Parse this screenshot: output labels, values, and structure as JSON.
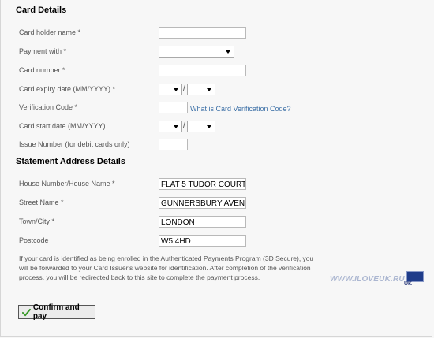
{
  "card_details": {
    "title": "Card Details",
    "holder_name_label": "Card holder name *",
    "payment_with_label": "Payment with *",
    "card_number_label": "Card number *",
    "expiry_label": "Card expiry date (MM/YYYY) *",
    "verification_label": "Verification Code *",
    "verification_link": "What is Card Verification Code?",
    "start_date_label": "Card start date (MM/YYYY)",
    "issue_number_label": "Issue Number (for debit cards only)",
    "date_separator": "/"
  },
  "address_details": {
    "title": "Statement Address Details",
    "house_label": "House Number/House Name *",
    "house_value": "FLAT 5 TUDOR COURT",
    "street_label": "Street Name *",
    "street_value": "GUNNERSBURY AVENU",
    "town_label": "Town/City *",
    "town_value": "LONDON",
    "postcode_label": "Postcode",
    "postcode_value": "W5 4HD"
  },
  "notice": "If your card is identified as being enrolled in the Authenticated Payments Program (3D Secure), you will be forwarded to your Card Issuer's website for identification. After completion of the verification process, you will be redirected back to this site to complete the payment process.",
  "confirm_button": "Confirm and pay",
  "watermark": {
    "text": "WWW.ILOVEUK.RU",
    "badge_text": "UK"
  },
  "colors": {
    "link": "#3b6fa6",
    "check": "#3a9a2a"
  }
}
